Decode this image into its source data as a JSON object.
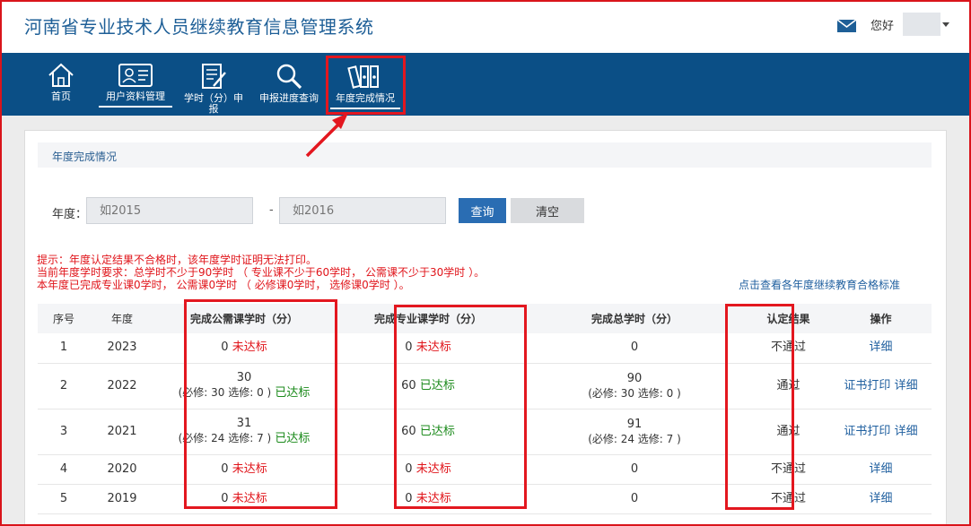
{
  "header": {
    "title": "河南省专业技术人员继续教育信息管理系统",
    "greeting": "您好"
  },
  "nav": {
    "items": [
      {
        "label": "首页"
      },
      {
        "label": "用户资料管理"
      },
      {
        "label": "学时（分）申报"
      },
      {
        "label": "申报进度查询"
      },
      {
        "label": "年度完成情况"
      }
    ]
  },
  "panel": {
    "title": "年度完成情况"
  },
  "filter": {
    "year_label": "年度：",
    "from_placeholder": "如2015",
    "separator": "-",
    "to_placeholder": "如2016",
    "query_label": "查询",
    "clear_label": "清空"
  },
  "hints": {
    "line1": "提示：年度认定结果不合格时，该年度学时证明无法打印。",
    "line2": "当前年度学时要求：总学时不少于90学时 （ 专业课不少于60学时， 公需课不少于30学时 ）。",
    "line3": "本年度已完成专业课0学时， 公需课0学时 （ 必修课0学时， 选修课0学时 ）。",
    "standard_link": "点击查看各年度继续教育合格标准"
  },
  "table": {
    "headers": [
      "序号",
      "年度",
      "完成公需课学时（分）",
      "完成专业课学时（分）",
      "完成总学时（分）",
      "认定结果",
      "操作"
    ],
    "rows": [
      {
        "no": "1",
        "year": "2023",
        "public_val": "0",
        "public_sub": "",
        "public_status": "未达标",
        "pro_val": "0",
        "pro_status": "未达标",
        "total_val": "0",
        "total_sub": "",
        "result": "不通过",
        "op_print": "",
        "op_detail": "详细"
      },
      {
        "no": "2",
        "year": "2022",
        "public_val": "30",
        "public_sub": "(必修: 30 选修: 0 )",
        "public_status": "已达标",
        "pro_val": "60",
        "pro_status": "已达标",
        "total_val": "90",
        "total_sub": "(必修: 30 选修: 0 )",
        "result": "通过",
        "op_print": "证书打印",
        "op_detail": "详细"
      },
      {
        "no": "3",
        "year": "2021",
        "public_val": "31",
        "public_sub": "(必修: 24 选修: 7 )",
        "public_status": "已达标",
        "pro_val": "60",
        "pro_status": "已达标",
        "total_val": "91",
        "total_sub": "(必修: 24 选修: 7 )",
        "result": "通过",
        "op_print": "证书打印",
        "op_detail": "详细"
      },
      {
        "no": "4",
        "year": "2020",
        "public_val": "0",
        "public_sub": "",
        "public_status": "未达标",
        "pro_val": "0",
        "pro_status": "未达标",
        "total_val": "0",
        "total_sub": "",
        "result": "不通过",
        "op_print": "",
        "op_detail": "详细"
      },
      {
        "no": "5",
        "year": "2019",
        "public_val": "0",
        "public_sub": "",
        "public_status": "未达标",
        "pro_val": "0",
        "pro_status": "未达标",
        "total_val": "0",
        "total_sub": "",
        "result": "不通过",
        "op_print": "",
        "op_detail": "详细"
      }
    ]
  },
  "colors": {
    "nav_bg": "#0b4f86",
    "title_blue": "#1e5f97",
    "warning_red": "#e0141a",
    "pass_green": "#1b8a1b",
    "annotation_red": "#e3171f"
  }
}
